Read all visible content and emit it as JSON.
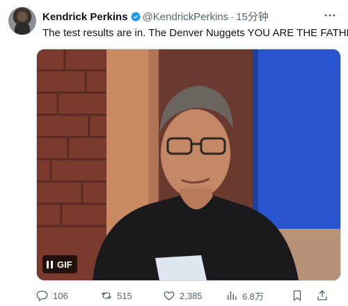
{
  "tweet": {
    "author_name": "Kendrick Perkins",
    "author_handle": "@KendrickPerkins",
    "separator": "·",
    "time": "15分钟",
    "text": "The test results are in. The Denver Nuggets YOU ARE THE FATHER",
    "media": {
      "badge_label": "GIF"
    },
    "actions": {
      "replies": "106",
      "reposts": "515",
      "likes": "2,385",
      "views": "6.8万"
    }
  },
  "icons": {
    "verified": "verified-badge-icon",
    "more": "more-options-icon",
    "pause": "pause-icon",
    "reply": "reply-icon",
    "repost": "repost-icon",
    "like": "heart-icon",
    "views": "analytics-icon",
    "bookmark": "bookmark-icon",
    "share": "share-icon"
  },
  "colors": {
    "verified": "#1d9bf0",
    "text": "#0f1419",
    "muted": "#536471"
  }
}
